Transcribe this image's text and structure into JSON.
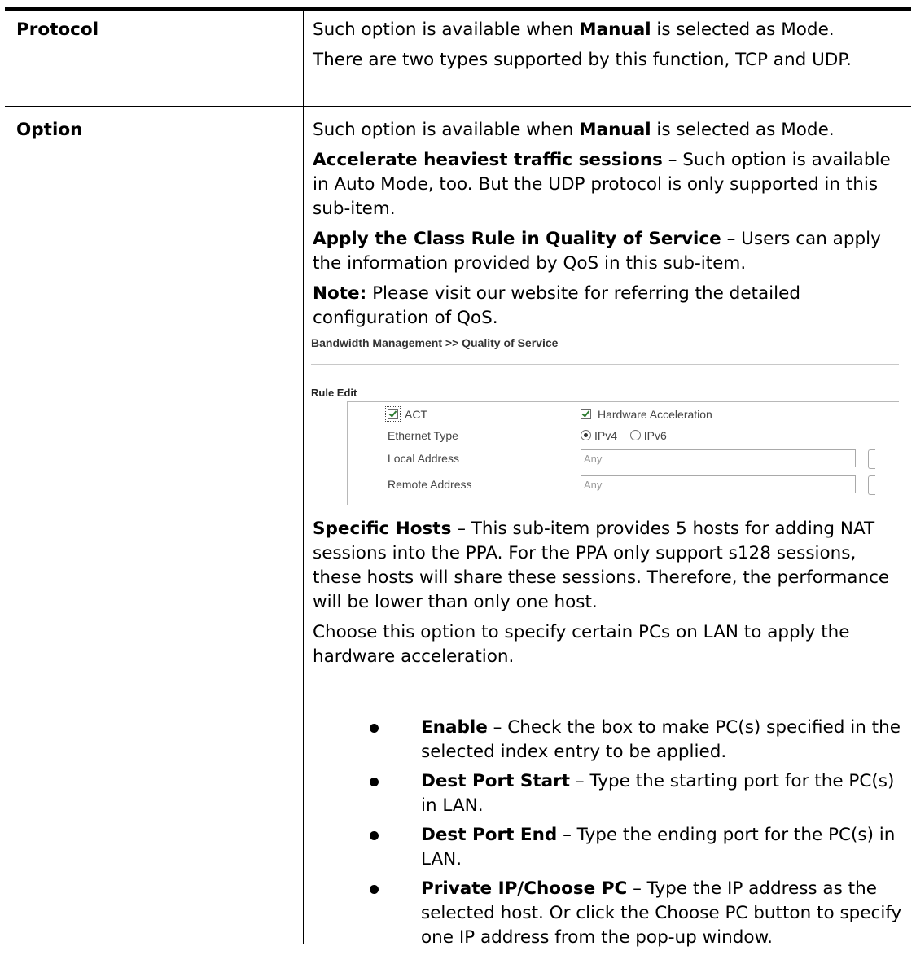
{
  "rows": [
    {
      "param": "Protocol",
      "paragraphs": [
        {
          "pre": "Such option is available when ",
          "bold": "Manual",
          "post": " is selected as Mode."
        },
        {
          "pre": "There are two types supported by this function, TCP and UDP.",
          "bold": "",
          "post": ""
        }
      ]
    },
    {
      "param": "Option",
      "intro": {
        "pre": "Such option is available when ",
        "bold": "Manual",
        "post": " is selected as Mode."
      },
      "items": [
        {
          "bold": "Accelerate heaviest traffic sessions",
          "text": " – Such option is available in Auto Mode, too. But the UDP protocol is only supported in this sub-item."
        },
        {
          "bold": "Apply the Class Rule in Quality of Service",
          "text": " – Users can apply the information provided by QoS in this sub-item."
        },
        {
          "bold": "Note:",
          "text": " Please visit our website for referring the detailed configuration of QoS."
        }
      ],
      "screenshot": {
        "breadcrumb": "Bandwidth Management >> Quality of Service",
        "section": "Rule Edit",
        "act_label": "ACT",
        "hw_accel_label": "Hardware Acceleration",
        "ethernet_type_label": "Ethernet Type",
        "ipv4_label": "IPv4",
        "ipv6_label": "IPv6",
        "local_address_label": "Local Address",
        "local_address_value": "Any",
        "remote_address_label": "Remote Address",
        "remote_address_value": "Any"
      },
      "specific_hosts": {
        "bold": "Specific Hosts",
        "text": " – This sub-item provides 5 hosts for adding NAT sessions into the PPA. For the PPA only support s128 sessions, these hosts will share these sessions. Therefore, the performance will be lower than only one host."
      },
      "choose_text": "Choose this option to specify certain PCs on LAN to apply the hardware acceleration.",
      "bullets": [
        {
          "bold": "Enable",
          "text": " – Check the box to make PC(s) specified in the selected index entry to be applied."
        },
        {
          "bold": "Dest Port Start",
          "text": " – Type the starting port for the PC(s) in LAN."
        },
        {
          "bold": "Dest Port End",
          "text": " – Type the ending port for the PC(s) in LAN."
        },
        {
          "bold": "Private IP/Choose PC",
          "text": " – Type the IP address as the selected host. Or click the Choose PC button to specify one IP address from the pop-up window."
        }
      ]
    }
  ]
}
